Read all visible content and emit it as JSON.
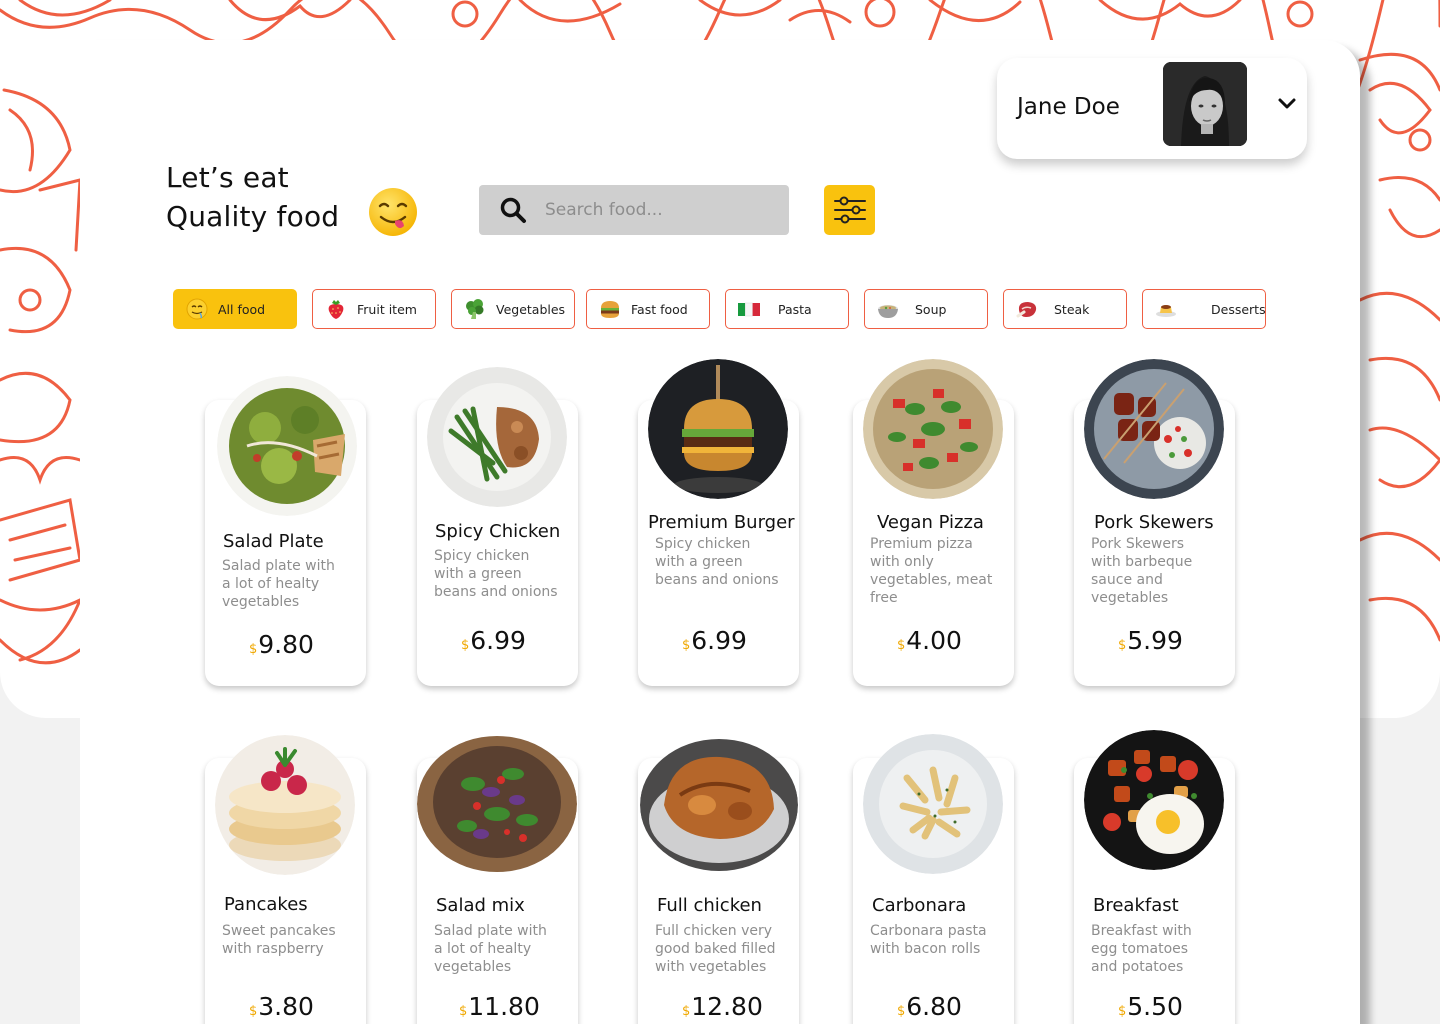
{
  "user": {
    "name": "Jane Doe"
  },
  "hero": {
    "line1": "Let’s eat",
    "line2": "Quality food"
  },
  "search": {
    "placeholder": "Search food..."
  },
  "currency": "$",
  "categories": [
    {
      "label": "All food",
      "icon": "drooling-face-icon",
      "active": true
    },
    {
      "label": "Fruit item",
      "icon": "strawberry-icon",
      "active": false
    },
    {
      "label": "Vegetables",
      "icon": "broccoli-icon",
      "active": false
    },
    {
      "label": "Fast food",
      "icon": "burger-icon",
      "active": false
    },
    {
      "label": "Pasta",
      "icon": "italy-flag-icon",
      "active": false
    },
    {
      "label": "Soup",
      "icon": "soup-bowl-icon",
      "active": false
    },
    {
      "label": "Steak",
      "icon": "steak-icon",
      "active": false
    },
    {
      "label": "Desserts",
      "icon": "custard-icon",
      "active": false
    }
  ],
  "foods": [
    {
      "name": "Salad Plate",
      "desc": "Salad plate with a lot of healty vegetables",
      "price": "9.80"
    },
    {
      "name": "Spicy Chicken",
      "desc": "Spicy chicken with a green beans and onions",
      "price": "6.99"
    },
    {
      "name": "Premium Burger",
      "desc": "Spicy chicken with a green beans and onions",
      "price": "6.99"
    },
    {
      "name": "Vegan Pizza",
      "desc": "Premium pizza with only vegetables, meat free",
      "price": "4.00"
    },
    {
      "name": "Pork Skewers",
      "desc": "Pork Skewers with barbeque sauce and vegetables",
      "price": "5.99"
    },
    {
      "name": "Pancakes",
      "desc": "Sweet pancakes with raspberry",
      "price": "3.80"
    },
    {
      "name": "Salad mix",
      "desc": "Salad plate with a lot of healty vegetables",
      "price": "11.80"
    },
    {
      "name": "Full chicken",
      "desc": "Full chicken very good baked filled with vegetables",
      "price": "12.80"
    },
    {
      "name": "Carbonara",
      "desc": "Carbonara pasta with bacon rolls",
      "price": "6.80"
    },
    {
      "name": "Breakfast",
      "desc": "Breakfast with egg tomatoes and potatoes",
      "price": "5.50"
    }
  ],
  "colors": {
    "accent": "#f9c20e",
    "doodle": "#ef5f43",
    "muted_text": "#8e8e8e"
  }
}
